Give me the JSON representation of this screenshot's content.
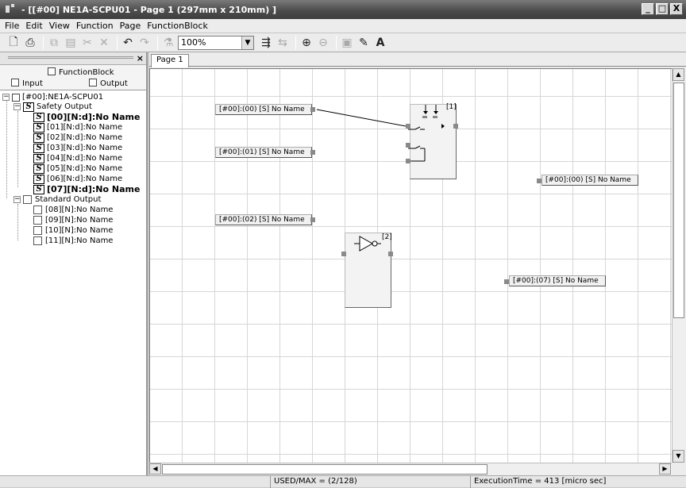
{
  "window": {
    "title": "- [[#00] NE1A-SCPU01 - Page 1 (297mm x 210mm) ]",
    "minimize": "_",
    "maximize": "□",
    "close": "X"
  },
  "menu": [
    {
      "label": "File"
    },
    {
      "label": "Edit"
    },
    {
      "label": "View"
    },
    {
      "label": "Function"
    },
    {
      "label": "Page"
    },
    {
      "label": "FunctionBlock"
    }
  ],
  "toolbar": {
    "zoom_value": "100%",
    "text_tool": "A",
    "icons": [
      "new-icon",
      "print-icon",
      "copy-icon",
      "paste-icon",
      "cut-icon",
      "delete-icon",
      "undo-icon",
      "redo-icon",
      "print-preview-icon",
      "zoom-dropdown",
      "align-icon",
      "distribute-icon",
      "page-add-icon",
      "page-remove-icon",
      "block-icon",
      "edit-icon",
      "text-icon"
    ]
  },
  "left_panel": {
    "close": "×",
    "function_block_label": "FunctionBlock",
    "input_label": "Input",
    "output_label": "Output",
    "tree": {
      "root": "[#00]:NE1A-SCPU01",
      "safety_group": "Safety Output",
      "safety_items": [
        {
          "label": "[00][N:d]:No Name",
          "bold": true
        },
        {
          "label": "[01][N:d]:No Name",
          "bold": false
        },
        {
          "label": "[02][N:d]:No Name",
          "bold": false
        },
        {
          "label": "[03][N:d]:No Name",
          "bold": false
        },
        {
          "label": "[04][N:d]:No Name",
          "bold": false
        },
        {
          "label": "[05][N:d]:No Name",
          "bold": false
        },
        {
          "label": "[06][N:d]:No Name",
          "bold": false
        },
        {
          "label": "[07][N:d]:No Name",
          "bold": true
        }
      ],
      "standard_group": "Standard Output",
      "standard_items": [
        "[08][N]:No Name",
        "[09][N]:No Name",
        "[10][N]:No Name",
        "[11][N]:No Name"
      ]
    }
  },
  "editor": {
    "tab": "Page 1",
    "input_tags": [
      "[#00]:(00) [S] No Name",
      "[#00]:(01) [S] No Name",
      "[#00]:(02) [S] No Name"
    ],
    "output_tags": [
      "[#00]:(00) [S] No Name",
      "[#00]:(07) [S] No Name"
    ],
    "blocks": [
      {
        "label": "[1]",
        "kind": "and-block"
      },
      {
        "label": "[2]",
        "kind": "not-block"
      }
    ]
  },
  "status": {
    "used_max": "USED/MAX = (2/128)",
    "execution_time": "ExecutionTime = 413 [micro sec]"
  }
}
